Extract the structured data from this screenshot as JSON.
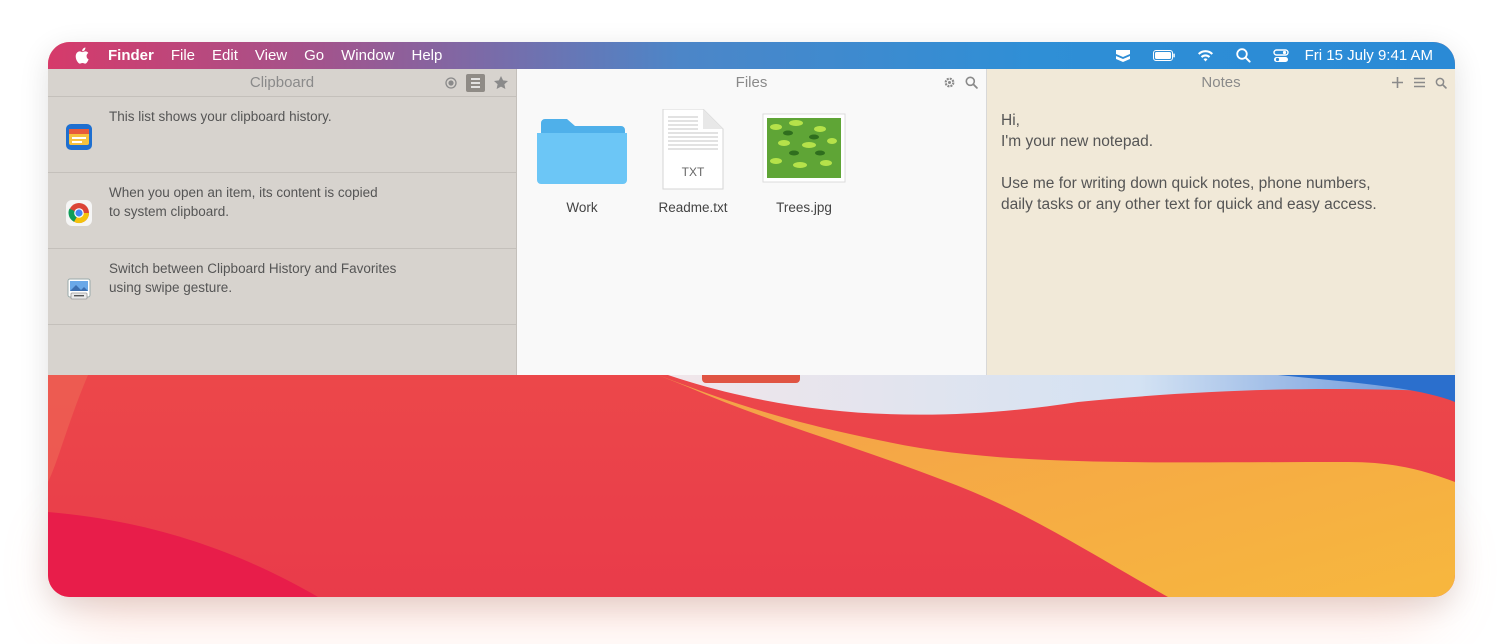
{
  "menubar": {
    "app_name": "Finder",
    "items": [
      "File",
      "Edit",
      "View",
      "Go",
      "Window",
      "Help"
    ],
    "clock": "Fri 15 July  9:41 AM",
    "status_icons": [
      "clipboard-app-icon",
      "battery-icon",
      "wifi-icon",
      "spotlight-search-icon",
      "control-center-icon"
    ]
  },
  "clipboard": {
    "title": "Clipboard",
    "tools": [
      "record-icon",
      "list-icon",
      "star-icon"
    ],
    "items": [
      {
        "text": "This list shows your clipboard history.",
        "icon": "notes-app-icon"
      },
      {
        "text": "When you open an item, its content is copied\nto system clipboard.",
        "icon": "chrome-icon"
      },
      {
        "text": "Switch between Clipboard History and Favorites\nusing swipe gesture.",
        "icon": "preview-app-icon"
      }
    ]
  },
  "files": {
    "title": "Files",
    "tools": [
      "gear-icon",
      "search-icon"
    ],
    "items": [
      {
        "name": "Work",
        "type": "folder"
      },
      {
        "name": "Readme.txt",
        "type": "txt",
        "badge": "TXT"
      },
      {
        "name": "Trees.jpg",
        "type": "image"
      }
    ]
  },
  "notes": {
    "title": "Notes",
    "tools": [
      "plus-icon",
      "list-icon",
      "search-icon"
    ],
    "lines": [
      "Hi,",
      "I'm your new notepad.",
      "",
      "Use me for writing down quick notes, phone numbers,",
      "daily tasks or any other text for quick and easy access."
    ]
  }
}
